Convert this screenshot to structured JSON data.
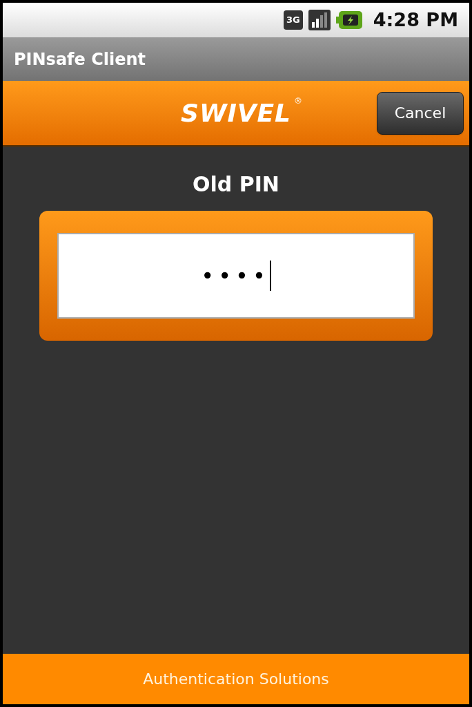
{
  "status_bar": {
    "network": "3G",
    "time": "4:28 PM"
  },
  "window": {
    "title": "PINsafe Client"
  },
  "header": {
    "logo": "SWIVEL",
    "logo_mark": "®",
    "cancel_button": "Cancel"
  },
  "prompt": {
    "label": "Old PIN",
    "value": "••••"
  },
  "footer": {
    "text": "Authentication Solutions"
  }
}
